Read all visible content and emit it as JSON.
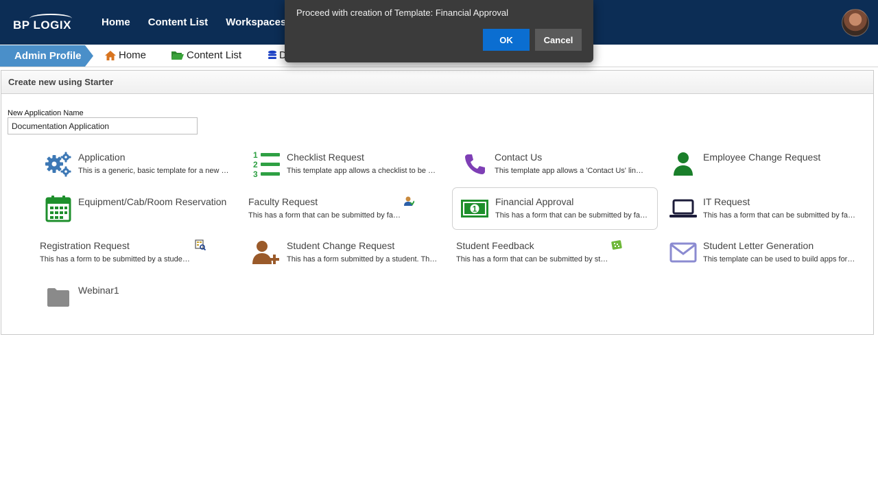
{
  "topbar": {
    "logo_text": "BP LOGIX",
    "nav": [
      {
        "label": "Home"
      },
      {
        "label": "Content List"
      },
      {
        "label": "Workspaces"
      }
    ]
  },
  "breadcrumb": {
    "admin_label": "Admin Profile",
    "items": [
      {
        "label": "Home",
        "icon": "home-icon"
      },
      {
        "label": "Content List",
        "icon": "folder-open-icon"
      },
      {
        "label": "D",
        "icon": "database-icon"
      }
    ]
  },
  "panel": {
    "header": "Create new using Starter",
    "name_label": "New Application Name",
    "name_value": "Documentation Application"
  },
  "templates": [
    {
      "title": "Application",
      "desc": "This is a generic, basic template for a new application",
      "icon": "gears-icon"
    },
    {
      "title": "Checklist Request",
      "desc": "This template app allows a checklist to be dynamically built",
      "icon": "checklist-icon"
    },
    {
      "title": "Contact Us",
      "desc": "This template app allows a 'Contact Us' link to be added",
      "icon": "phone-icon"
    },
    {
      "title": "Employee Change Request",
      "desc": "",
      "icon": "person-icon"
    },
    {
      "title": "Equipment/Cab/Room Reservation",
      "desc": "",
      "icon": "calendar-icon"
    },
    {
      "title": "Faculty Request",
      "desc": "This has a form that can be submitted by faculty members",
      "icon": "",
      "badge": "faculty-badge-icon"
    },
    {
      "title": "Financial Approval",
      "desc": "This has a form that can be submitted by faculty members",
      "icon": "money-icon"
    },
    {
      "title": "IT Request",
      "desc": "This has a form that can be submitted by faculty members",
      "icon": "laptop-icon"
    },
    {
      "title": "Registration Request",
      "desc": "This has a form to be submitted by a student for registration",
      "icon": "",
      "badge": "registration-badge-icon"
    },
    {
      "title": "Student Change Request",
      "desc": "This has a form submitted by a student. The form includes",
      "icon": "person-add-icon"
    },
    {
      "title": "Student Feedback",
      "desc": "This has a form that can be submitted by students",
      "icon": "",
      "badge": "feedback-badge-icon"
    },
    {
      "title": "Student Letter Generation",
      "desc": "This template can be used to build apps for letter generation",
      "icon": "envelope-icon"
    },
    {
      "title": "Webinar1",
      "desc": "",
      "icon": "folder-icon"
    }
  ],
  "dialog": {
    "message": "Proceed with creation of Template: Financial Approval",
    "ok_label": "OK",
    "cancel_label": "Cancel"
  },
  "colors": {
    "topbar": "#0c2d55",
    "crumb_active": "#4a8fc9",
    "ok_button": "#0b6ed1",
    "green_icon": "#1e8f2c",
    "blue_icon": "#3d78b5"
  }
}
